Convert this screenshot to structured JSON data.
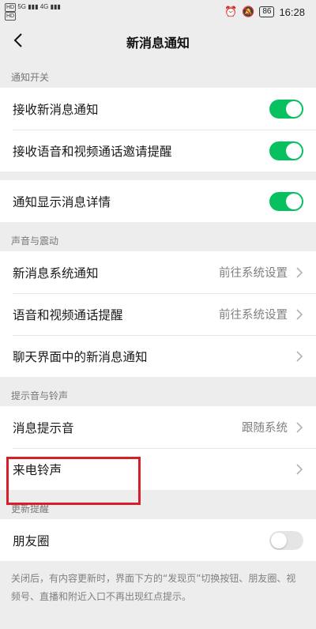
{
  "status_bar": {
    "signal_left": [
      "HD",
      "HD"
    ],
    "network_labels": [
      "5G",
      "4G"
    ],
    "battery": "86",
    "time": "16:28"
  },
  "nav": {
    "title": "新消息通知"
  },
  "sections": {
    "notify_switch": {
      "header": "通知开关",
      "receive_new": "接收新消息通知",
      "receive_call": "接收语音和视频通话邀请提醒",
      "show_detail": "通知显示消息详情"
    },
    "sound_vibration": {
      "header": "声音与震动",
      "new_msg_system": "新消息系统通知",
      "new_msg_system_value": "前往系统设置",
      "call_reminder": "语音和视频通话提醒",
      "call_reminder_value": "前往系统设置",
      "chat_new_msg": "聊天界面中的新消息通知"
    },
    "tone_ringtone": {
      "header": "提示音与铃声",
      "msg_tone": "消息提示音",
      "msg_tone_value": "跟随系统",
      "ringtone": "来电铃声"
    },
    "update_reminder": {
      "header": "更新提醒",
      "moments": "朋友圈",
      "footnote": "关闭后，有内容更新时，界面下方的“发现页”切换按钮、朋友圈、视频号、直播和附近入口不再出现红点提示。"
    }
  },
  "toggles": {
    "receive_new": true,
    "receive_call": true,
    "show_detail": true,
    "moments": false
  },
  "colors": {
    "toggle_on": "#07c160",
    "highlight": "#d5202a"
  }
}
